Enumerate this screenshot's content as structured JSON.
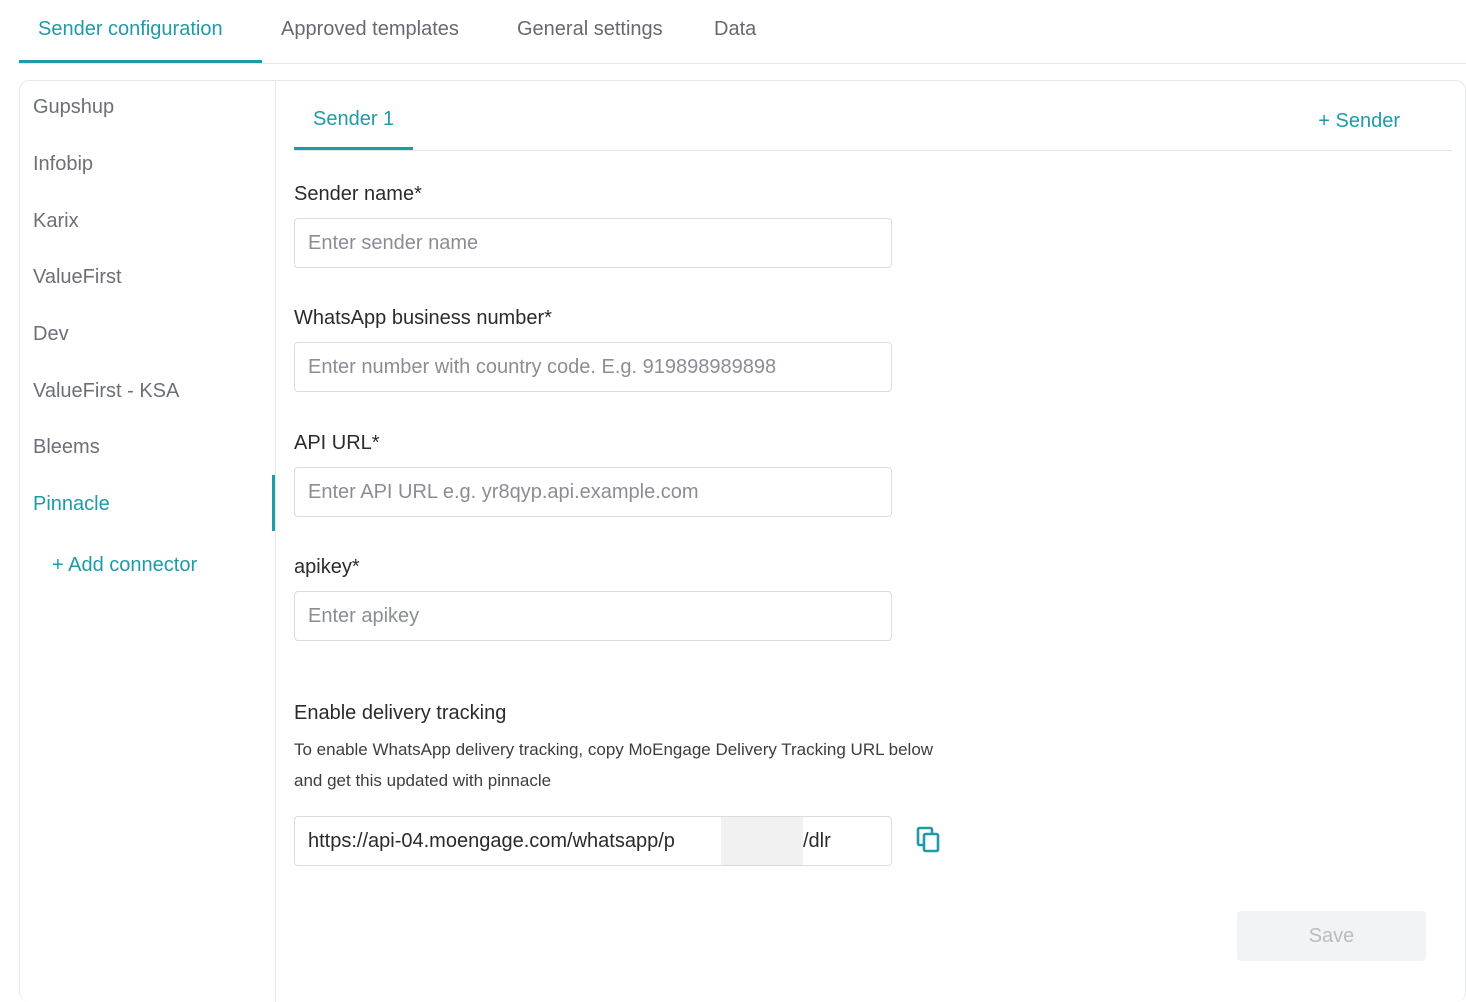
{
  "top_tabs": [
    {
      "label": "Sender configuration",
      "active": true
    },
    {
      "label": "Approved templates",
      "active": false
    },
    {
      "label": "General settings",
      "active": false
    },
    {
      "label": "Data",
      "active": false
    }
  ],
  "connectors": [
    {
      "label": "Gupshup"
    },
    {
      "label": "Infobip"
    },
    {
      "label": "Karix"
    },
    {
      "label": "ValueFirst"
    },
    {
      "label": "Dev"
    },
    {
      "label": "ValueFirst - KSA"
    },
    {
      "label": "Bleems"
    },
    {
      "label": "Pinnacle",
      "active": true
    }
  ],
  "add_connector_label": "+ Add connector",
  "sender_tabs": {
    "active_label": "Sender 1",
    "add_sender_label": "+ Sender"
  },
  "form": {
    "sender_name": {
      "label": "Sender name*",
      "placeholder": "Enter sender name",
      "value": ""
    },
    "business_number": {
      "label": "WhatsApp business number*",
      "placeholder": "Enter number with country code. E.g. 919898989898",
      "value": ""
    },
    "api_url": {
      "label": "API URL*",
      "placeholder": "Enter API URL e.g. yr8qyp.api.example.com",
      "value": ""
    },
    "apikey": {
      "label": "apikey*",
      "placeholder": "Enter apikey",
      "value": ""
    }
  },
  "delivery_tracking": {
    "title": "Enable delivery tracking",
    "description_line1": "To enable WhatsApp delivery tracking, copy MoEngage Delivery Tracking URL below",
    "description_line2": "and get this updated with pinnacle",
    "url_prefix": "https://api-04.moengage.com/whatsapp/p",
    "url_suffix": "/dlr",
    "copy_icon": "copy-icon"
  },
  "save_label": "Save",
  "colors": {
    "accent": "#1f9aa8",
    "muted_text": "#6c7076",
    "border": "#e5e8eb"
  }
}
